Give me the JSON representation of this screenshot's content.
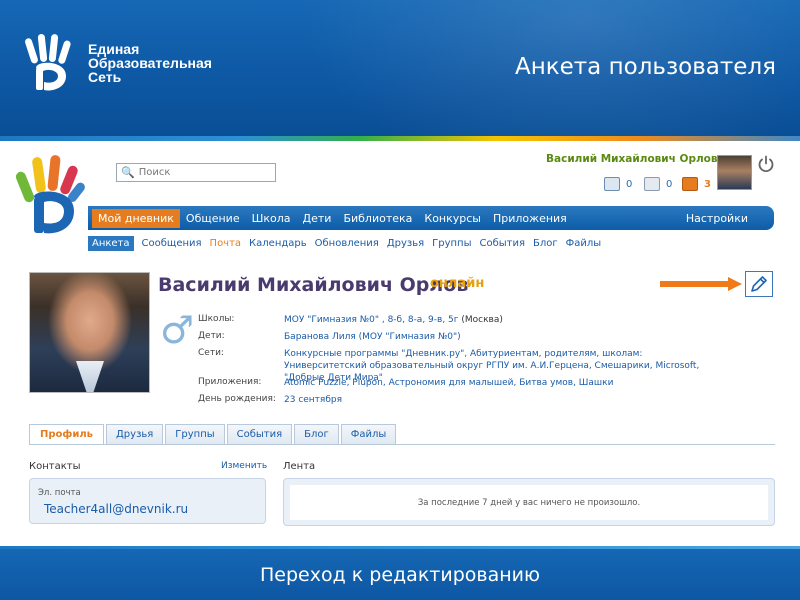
{
  "slide": {
    "brand_lines": [
      "Единая",
      "Образовательная",
      "Сеть"
    ],
    "title": "Анкета пользователя",
    "footer": "Переход к редактированию"
  },
  "colors": {
    "accent_orange": "#e57d20",
    "nav_blue": "#0d5ca8",
    "link_blue": "#1a5ca8",
    "username_green": "#5a8a12",
    "online_yellow": "#e6a010"
  },
  "header": {
    "search_placeholder": "Поиск",
    "user_name": "Василий Михайлович Орлов",
    "notifications": [
      {
        "icon": "mail-icon",
        "count": "0"
      },
      {
        "icon": "friend-request-icon",
        "count": "0"
      },
      {
        "icon": "app-invite-icon",
        "count": "3"
      }
    ]
  },
  "nav": {
    "items": [
      "Мой дневник",
      "Общение",
      "Школа",
      "Дети",
      "Библиотека",
      "Конкурсы",
      "Приложения"
    ],
    "right": "Настройки"
  },
  "subnav": {
    "items": [
      "Анкета",
      "Сообщения",
      "Почта",
      "Календарь",
      "Обновления",
      "Друзья",
      "Группы",
      "События",
      "Блог",
      "Файлы"
    ]
  },
  "profile": {
    "name": "Василий Михайлович Орлов",
    "status": "онлайн",
    "gender_symbol": "♂",
    "rows": [
      {
        "label": "Школы:",
        "value": "МОУ \"Гимназия №0\" , 8-б, 8-а, 9-в, 5г",
        "extra": "(Москва)"
      },
      {
        "label": "Дети:",
        "value": "Баранова Лиля",
        "extra": "(МОУ \"Гимназия №0\")"
      },
      {
        "label": "Сети:",
        "value": "Конкурсные программы \"Дневник.ру\", Абитуриентам, родителям, школам: Университетский образовательный округ РГПУ им. А.И.Герцена, Смешарики, Microsoft, \"Добрые Дети Мира\"",
        "extra": ""
      },
      {
        "label": "Приложения:",
        "value": "Atomic Puzzle, Plupon, Астрономия для малышей, Битва умов, Шашки",
        "extra": ""
      },
      {
        "label": "День рождения:",
        "value": "23 сентября",
        "extra": ""
      }
    ]
  },
  "tabs": [
    "Профиль",
    "Друзья",
    "Группы",
    "События",
    "Блог",
    "Файлы"
  ],
  "contacts": {
    "heading": "Контакты",
    "edit_link": "Изменить",
    "email_label": "Эл. почта",
    "email_value": "Teacher4all@dnevnik.ru"
  },
  "feed": {
    "heading": "Лента",
    "empty_message": "За последние 7 дней у вас ничего не произошло."
  }
}
